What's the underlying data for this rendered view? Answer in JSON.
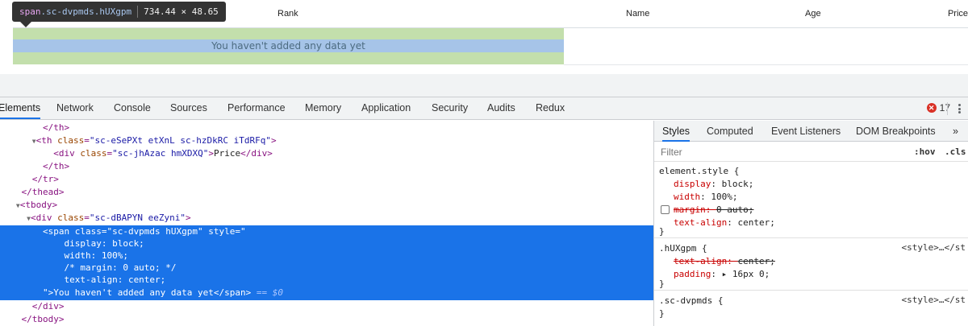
{
  "page": {
    "tooltip": {
      "tag": "span",
      "class_name": ".sc-dvpmds.hUXgpm",
      "dimensions": "734.44 × 48.65"
    },
    "table": {
      "headers": [
        "Rank",
        "Name",
        "Age",
        "Price"
      ],
      "empty_message": "You haven't added any data yet"
    }
  },
  "devtools": {
    "tabs": [
      "Elements",
      "Network",
      "Console",
      "Sources",
      "Performance",
      "Memory",
      "Application",
      "Security",
      "Audits",
      "Redux"
    ],
    "active_tab": "Elements",
    "error_count": "17",
    "dom_lines": [
      {
        "indent": "        ",
        "text": "</th>"
      },
      {
        "indent": "      ",
        "open": "<th ",
        "attr": "class",
        "value": "\"sc-eSePXt etXnL sc-hzDkRC iTdRFq\"",
        "close": ">"
      },
      {
        "indent": "          ",
        "open": "<div ",
        "attr": "class",
        "value": "\"sc-jhAzac hmXDXQ\"",
        "close": ">",
        "text": "Price",
        "end": "</div>"
      },
      {
        "indent": "        ",
        "text": "</th>"
      },
      {
        "indent": "      ",
        "text": "</tr>"
      },
      {
        "indent": "    ",
        "text": "</thead>"
      },
      {
        "indent": "   ",
        "text": "<tbody>"
      },
      {
        "indent": "     ",
        "open": "<div ",
        "attr": "class",
        "value": "\"sc-dBAPYN eeZyni\"",
        "close": ">"
      }
    ],
    "selected_lines": [
      "        <span class=\"sc-dvpmds hUXgpm\" style=\"",
      "            display: block;",
      "            width: 100%;",
      "            /* margin: 0 auto; */",
      "            text-align: center;",
      "        \">You haven't added any data yet</span>"
    ],
    "selected_suffix": "== $0",
    "after_lines": [
      {
        "indent": "      ",
        "text": "</div>"
      },
      {
        "indent": "    ",
        "text": "</tbody>"
      }
    ],
    "styles": {
      "tabs": [
        "Styles",
        "Computed",
        "Event Listeners",
        "DOM Breakpoints",
        "»"
      ],
      "active_tab": "Styles",
      "filter_placeholder": "Filter",
      "hov": ":hov",
      "cls": ".cls",
      "rules": [
        {
          "selector": "element.style {",
          "source": "",
          "decls": [
            {
              "prop": "display",
              "value": "block;",
              "struck": false
            },
            {
              "prop": "width",
              "value": "100%;",
              "struck": false
            },
            {
              "prop": "margin",
              "value": "0 auto;",
              "struck": true,
              "checkbox": true
            },
            {
              "prop": "text-align",
              "value": "center;",
              "struck": false
            }
          ]
        },
        {
          "selector": ".hUXgpm {",
          "source": "<style>…</st",
          "decls": [
            {
              "prop": "text-align",
              "value": "center;",
              "struck": true
            },
            {
              "prop": "padding",
              "value": "▸ 16px 0;",
              "struck": false
            }
          ]
        },
        {
          "selector": ".sc-dvpmds {",
          "source": "<style>…</st",
          "decls": []
        }
      ]
    }
  },
  "colors": {
    "selection": "#1a73e8",
    "padding_highlight": "#c3dfac",
    "content_highlight": "#a6c4e8",
    "error": "#d93025"
  }
}
